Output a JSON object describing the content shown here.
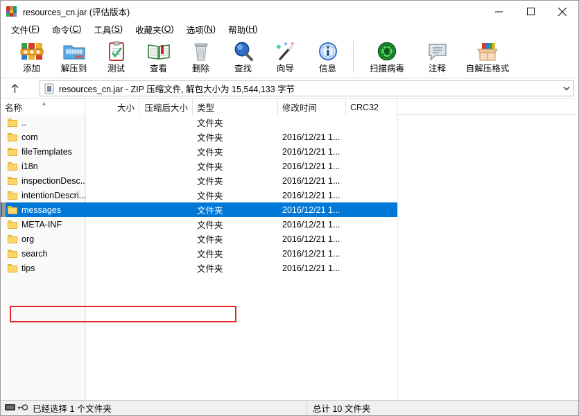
{
  "window": {
    "title": "resources_cn.jar (评估版本)",
    "icon": "winrar-books-icon",
    "controls": {
      "minimize": "minimize-icon",
      "maximize": "maximize-icon",
      "close": "close-icon"
    }
  },
  "menubar": {
    "items": [
      {
        "name": "file",
        "text": "文件",
        "accel": "F"
      },
      {
        "name": "commands",
        "text": "命令",
        "accel": "C"
      },
      {
        "name": "tools",
        "text": "工具",
        "accel": "S"
      },
      {
        "name": "favorites",
        "text": "收藏夹",
        "accel": "O"
      },
      {
        "name": "options",
        "text": "选项",
        "accel": "N"
      },
      {
        "name": "help",
        "text": "帮助",
        "accel": "H"
      }
    ]
  },
  "toolbar": {
    "buttons": [
      {
        "name": "add",
        "label": "添加",
        "icon": "rar-add-icon"
      },
      {
        "name": "extract-to",
        "label": "解压到",
        "icon": "extract-folder-icon"
      },
      {
        "name": "test",
        "label": "测试",
        "icon": "clipboard-check-icon"
      },
      {
        "name": "view",
        "label": "查看",
        "icon": "open-book-icon"
      },
      {
        "name": "delete",
        "label": "删除",
        "icon": "trash-bin-icon"
      },
      {
        "name": "find",
        "label": "查找",
        "icon": "magnifier-icon"
      },
      {
        "name": "wizard",
        "label": "向导",
        "icon": "magic-wand-icon"
      },
      {
        "name": "info",
        "label": "信息",
        "icon": "info-circle-icon"
      },
      {
        "name": "scan-virus",
        "label": "扫描病毒",
        "icon": "virus-shield-icon"
      },
      {
        "name": "comment",
        "label": "注释",
        "icon": "comment-bubble-icon"
      },
      {
        "name": "sfx",
        "label": "自解压格式",
        "icon": "sfx-box-icon"
      }
    ]
  },
  "addressbar": {
    "up_icon": "up-arrow-icon",
    "path_icon": "jar-file-icon",
    "path_text": "resources_cn.jar - ZIP 压缩文件, 解包大小为 15,544,133 字节",
    "dropdown_icon": "chevron-down-icon"
  },
  "filelist": {
    "columns": [
      {
        "name": "name",
        "label": "名称",
        "sort": "asc"
      },
      {
        "name": "size",
        "label": "大小"
      },
      {
        "name": "packed",
        "label": "压缩后大小"
      },
      {
        "name": "type",
        "label": "类型"
      },
      {
        "name": "modified",
        "label": "修改时间"
      },
      {
        "name": "crc32",
        "label": "CRC32"
      }
    ],
    "rows": [
      {
        "name": "..",
        "size": "",
        "packed": "",
        "type": "文件夹",
        "modified": "",
        "crc32": "",
        "selected": false
      },
      {
        "name": "com",
        "size": "",
        "packed": "",
        "type": "文件夹",
        "modified": "2016/12/21 1...",
        "crc32": "",
        "selected": false
      },
      {
        "name": "fileTemplates",
        "size": "",
        "packed": "",
        "type": "文件夹",
        "modified": "2016/12/21 1...",
        "crc32": "",
        "selected": false
      },
      {
        "name": "i18n",
        "size": "",
        "packed": "",
        "type": "文件夹",
        "modified": "2016/12/21 1...",
        "crc32": "",
        "selected": false
      },
      {
        "name": "inspectionDesc...",
        "size": "",
        "packed": "",
        "type": "文件夹",
        "modified": "2016/12/21 1...",
        "crc32": "",
        "selected": false
      },
      {
        "name": "intentionDescri...",
        "size": "",
        "packed": "",
        "type": "文件夹",
        "modified": "2016/12/21 1...",
        "crc32": "",
        "selected": false
      },
      {
        "name": "messages",
        "size": "",
        "packed": "",
        "type": "文件夹",
        "modified": "2016/12/21 1...",
        "crc32": "",
        "selected": true
      },
      {
        "name": "META-INF",
        "size": "",
        "packed": "",
        "type": "文件夹",
        "modified": "2016/12/21 1...",
        "crc32": "",
        "selected": false
      },
      {
        "name": "org",
        "size": "",
        "packed": "",
        "type": "文件夹",
        "modified": "2016/12/21 1...",
        "crc32": "",
        "selected": false
      },
      {
        "name": "search",
        "size": "",
        "packed": "",
        "type": "文件夹",
        "modified": "2016/12/21 1...",
        "crc32": "",
        "selected": false
      },
      {
        "name": "tips",
        "size": "",
        "packed": "",
        "type": "文件夹",
        "modified": "2016/12/21 1...",
        "crc32": "",
        "selected": false
      }
    ]
  },
  "annotation": {
    "highlight_color": "#e8252a",
    "target_row": "messages"
  },
  "statusbar": {
    "left_text": "已经选择 1 个文件夹",
    "right_text": "总计 10 文件夹",
    "icons": [
      "drive-icon",
      "key-icon"
    ]
  },
  "colors": {
    "selection": "#0078d7",
    "folder": "#fcd667",
    "annotation": "#e8252a"
  }
}
